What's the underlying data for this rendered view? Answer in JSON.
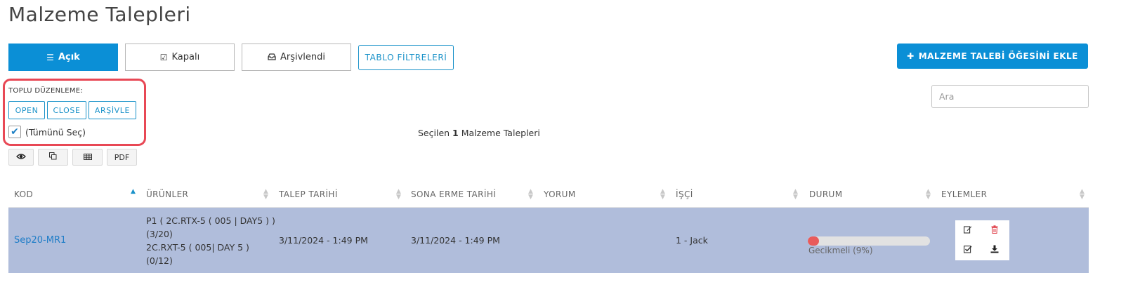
{
  "page": {
    "title": "Malzeme Talepleri"
  },
  "tabs": [
    {
      "label": "Açık",
      "icon": "list-icon",
      "active": true
    },
    {
      "label": "Kapalı",
      "icon": "check-square-icon",
      "active": false
    },
    {
      "label": "Arşivlendi",
      "icon": "inbox-icon",
      "active": false
    }
  ],
  "toolbar": {
    "filter_label": "TABLO FİLTRELERİ",
    "add_label": "MALZEME TALEBİ ÖĞESİNİ EKLE",
    "search_placeholder": "Ara"
  },
  "bulk_edit": {
    "label": "TOPLU DÜZENLEME:",
    "buttons": [
      "OPEN",
      "CLOSE",
      "ARŞİVLE"
    ],
    "select_all_label": "(Tümünü Seç)",
    "select_all_checked": true
  },
  "selection": {
    "prefix": "Seçilen",
    "count": "1",
    "suffix": "Malzeme Talepleri"
  },
  "export_buttons": [
    {
      "icon": "eye-icon"
    },
    {
      "icon": "copy-icon"
    },
    {
      "icon": "table-icon"
    },
    {
      "label": "PDF"
    }
  ],
  "table": {
    "columns": [
      "KOD",
      "ÜRÜNLER",
      "TALEP TARİHİ",
      "SONA ERME TARİHİ",
      "YORUM",
      "İŞÇİ",
      "DURUM",
      "EYLEMLER"
    ],
    "rows": [
      {
        "kod": "Sep20-MR1",
        "urunler": [
          "P1 ( 2C.RTX-5 ( 005 | DAY5 ) )",
          "(3/20)",
          "2C.RXT-5 ( 005| DAY 5 )",
          "(0/12)"
        ],
        "talep_tarihi": "3/11/2024 - 1:49 PM",
        "sona_erme_tarihi": "3/11/2024 - 1:49 PM",
        "yorum": "",
        "isci": "1 - Jack",
        "durum": "Gecikmeli (9%)",
        "progress_percent": 9
      }
    ]
  },
  "colors": {
    "primary": "#0b8fd6",
    "link": "#1f7dc7",
    "selected_row": "#b0bddb",
    "highlight_border": "#e84855",
    "progress_fill": "#e95b5b",
    "delete_icon": "#e0454f"
  }
}
